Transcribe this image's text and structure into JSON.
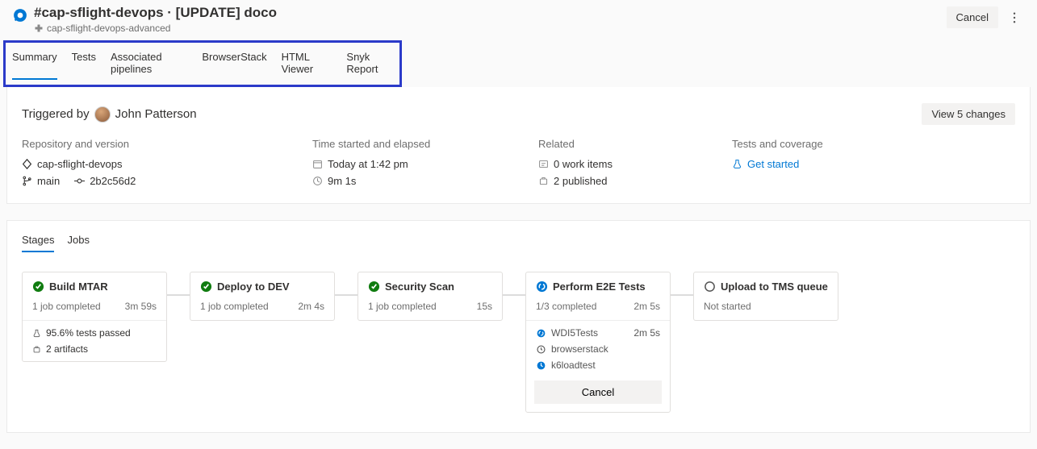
{
  "header": {
    "title": "#cap-sflight-devops · [UPDATE] doco",
    "subtitle": "cap-sflight-devops-advanced",
    "cancel": "Cancel"
  },
  "tabs": {
    "items": [
      {
        "label": "Summary",
        "active": true
      },
      {
        "label": "Tests"
      },
      {
        "label": "Associated pipelines"
      },
      {
        "label": "BrowserStack"
      },
      {
        "label": "HTML Viewer"
      },
      {
        "label": "Snyk Report"
      }
    ]
  },
  "summary": {
    "triggered_prefix": "Triggered by",
    "triggered_user": "John Patterson",
    "view_changes": "View 5 changes",
    "repo": {
      "label": "Repository and version",
      "repo_name": "cap-sflight-devops",
      "branch": "main",
      "commit": "2b2c56d2"
    },
    "time": {
      "label": "Time started and elapsed",
      "started": "Today at 1:42 pm",
      "elapsed": "9m 1s"
    },
    "related": {
      "label": "Related",
      "work_items": "0 work items",
      "published": "2 published"
    },
    "tests": {
      "label": "Tests and coverage",
      "get_started": "Get started"
    }
  },
  "stages": {
    "tabs": [
      {
        "label": "Stages",
        "active": true
      },
      {
        "label": "Jobs"
      }
    ],
    "cards": [
      {
        "name": "Build MTAR",
        "status": "success",
        "jobs_text": "1 job completed",
        "duration": "3m 59s",
        "extras": [
          {
            "icon": "beaker",
            "text": "95.6% tests passed"
          },
          {
            "icon": "artifact",
            "text": "2 artifacts"
          }
        ]
      },
      {
        "name": "Deploy to DEV",
        "status": "success",
        "jobs_text": "1 job completed",
        "duration": "2m 4s"
      },
      {
        "name": "Security Scan",
        "status": "success",
        "jobs_text": "1 job completed",
        "duration": "15s"
      },
      {
        "name": "Perform E2E Tests",
        "status": "running",
        "jobs_text": "1/3 completed",
        "duration": "2m 5s",
        "jobs": [
          {
            "icon": "running",
            "label": "WDI5Tests",
            "time": "2m 5s"
          },
          {
            "icon": "pending",
            "label": "browserstack"
          },
          {
            "icon": "queued",
            "label": "k6loadtest"
          }
        ],
        "cancel": "Cancel"
      },
      {
        "name": "Upload to TMS queue",
        "status": "notstarted",
        "jobs_text": "Not started"
      }
    ]
  }
}
